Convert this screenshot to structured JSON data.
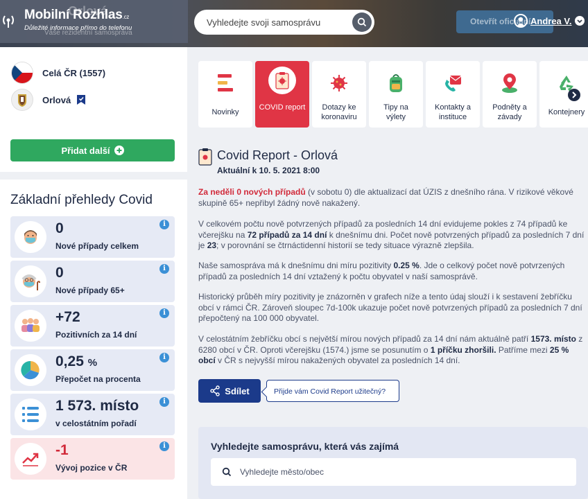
{
  "header": {
    "brand": "Mobilní Rozhlas",
    "brand_suffix": ".cz",
    "tagline": "Důležité informace přímo do telefonu",
    "ghost_title": "Orlová",
    "ghost_subtitle": "Váše rezidentní samospráva",
    "search_placeholder": "Vyhledejte svoji samosprávu",
    "open_button": "Otevřít oficiální",
    "user_name": "Andrea V."
  },
  "places": {
    "items": [
      {
        "label": "Celá ČR (1557)",
        "icon": "czech-flag-icon"
      },
      {
        "label": "Orlová",
        "icon": "orlova-coat-of-arms-icon"
      }
    ],
    "add_button": "Přidat další"
  },
  "stats": {
    "title": "Základní přehledy Covid",
    "items": [
      {
        "value": "0",
        "label": "Nové případy celkem",
        "icon": "masked-person-icon"
      },
      {
        "value": "0",
        "label": "Nové případy 65+",
        "icon": "elderly-masked-person-icon"
      },
      {
        "value": "+72",
        "label": "Pozitivních za 14 dní",
        "icon": "people-group-icon"
      },
      {
        "value": "0,25",
        "unit": "%",
        "label": "Přepočet na procenta",
        "icon": "pie-chart-icon"
      },
      {
        "value": "1 573. místo",
        "label": "v celostátním pořadí",
        "icon": "ranking-list-icon"
      },
      {
        "value": "-1",
        "label": "Vývoj pozice v ČR",
        "icon": "trend-chart-icon"
      }
    ]
  },
  "tiles": [
    {
      "label": "Novinky",
      "icon": "news-icon"
    },
    {
      "label": "COVID report",
      "icon": "covid-report-icon",
      "active": true
    },
    {
      "label": "Dotazy ke koronaviru",
      "icon": "virus-icon"
    },
    {
      "label": "Tipy na výlety",
      "icon": "backpack-icon"
    },
    {
      "label": "Kontakty a instituce",
      "icon": "contacts-icon"
    },
    {
      "label": "Podněty a závady",
      "icon": "map-pin-icon"
    },
    {
      "label": "Kontejnery",
      "icon": "recycle-icon"
    }
  ],
  "report": {
    "title": "Covid Report - Orlová",
    "date": "Aktuální k 10. 5. 2021 8:00",
    "p1_highlight": "Za neděli 0 nových případů",
    "p1_rest": " (v sobotu 0) dle aktualizací dat ÚZIS z dnešního rána. V rizikové věkové skupině 65+ nepřibyl žádný nově nakažený.",
    "p2_a": "V celkovém počtu nově potvrzených případů za posledních 14 dní evidujeme pokles z 74 případů ke včerejšku na ",
    "p2_b": "72 případů za 14 dní",
    "p2_c": " k dnešnímu dni. Počet nově potvrzených případů za posledních 7 dní je ",
    "p2_d": "23",
    "p2_e": "; v porovnání se čtrnáctidenní historií se tedy situace výrazně zlepšila.",
    "p3_a": "Naše samospráva má k dnešnímu dni míru pozitivity ",
    "p3_b": "0.25 %",
    "p3_c": ". Jde o celkový počet nově potvrzených případů za posledních 14 dní vztažený k počtu obyvatel v naší samosprávě.",
    "p4": "Historický průběh míry pozitivity je znázorněn v grafech níže a tento údaj slouží i k sestavení žebříčku obcí v rámci ČR. Zároveň sloupec 7d-100k ukazuje počet nově potvrzených případů za posledních 7 dní přepočtený na 100 000 obyvatel.",
    "p5_a": "V celostátním žebříčku obcí s největší mírou nových případů za 14 dní nám aktuálně patří ",
    "p5_b": "1573. místo",
    "p5_c": " z 6280 obcí v ČR. Oproti včerejšku (1574.) jsme se posunutím o ",
    "p5_d": "1 příčku zhoršili.",
    "p5_e": " Patříme mezi ",
    "p5_f": "25 % obcí",
    "p5_g": " v ČR s nejvyšší mírou nakažených obyvatel za posledních 14 dní.",
    "share_button": "Sdílet",
    "useful_prompt": "Přijde vám Covid Report užitečný?"
  },
  "search_section": {
    "title": "Vyhledejte samosprávu, která vás zajímá",
    "placeholder": "Vyhledejte město/obec"
  },
  "colors": {
    "accent_red": "#e03545",
    "green": "#2fa85f",
    "navy": "#1b3a8a",
    "info_blue": "#3b90d6"
  }
}
